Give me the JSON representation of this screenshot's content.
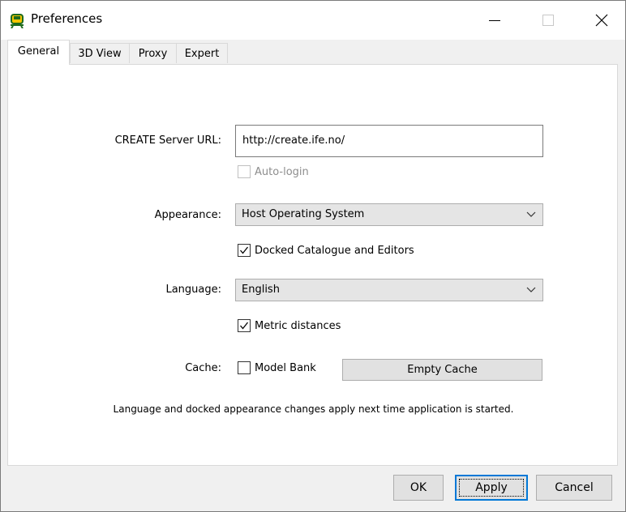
{
  "window": {
    "title": "Preferences",
    "controls": {
      "minimize": "minimize",
      "maximize": "maximize",
      "close": "close"
    }
  },
  "tabs": [
    {
      "label": "General",
      "active": true
    },
    {
      "label": "3D View",
      "active": false
    },
    {
      "label": "Proxy",
      "active": false
    },
    {
      "label": "Expert",
      "active": false
    }
  ],
  "general": {
    "server_url_label": "CREATE Server URL:",
    "server_url_value": "http://create.ife.no/",
    "auto_login_label": "Auto-login",
    "auto_login_checked": false,
    "auto_login_enabled": false,
    "appearance_label": "Appearance:",
    "appearance_value": "Host Operating System",
    "docked_label": "Docked Catalogue and Editors",
    "docked_checked": true,
    "language_label": "Language:",
    "language_value": "English",
    "metric_label": "Metric distances",
    "metric_checked": true,
    "cache_label": "Cache:",
    "model_bank_label": "Model Bank",
    "model_bank_checked": false,
    "empty_cache_label": "Empty Cache",
    "note": "Language and docked appearance changes apply next time application is started."
  },
  "buttons": {
    "ok": "OK",
    "apply": "Apply",
    "cancel": "Cancel"
  },
  "colors": {
    "focus_border": "#0078d7",
    "panel": "#ffffff",
    "chrome": "#f0f0f0"
  }
}
